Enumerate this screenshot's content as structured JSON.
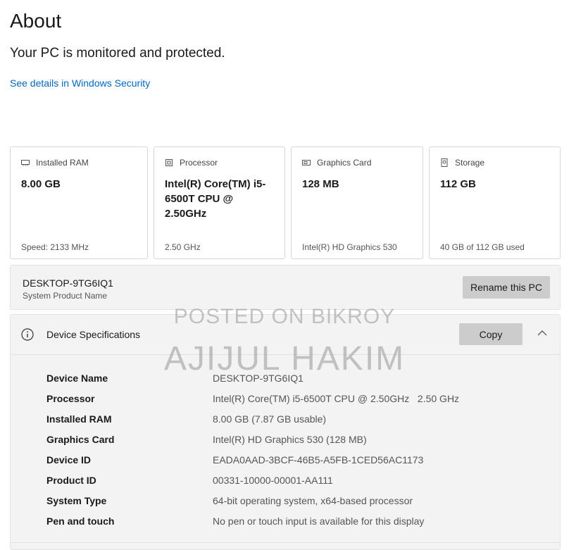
{
  "page": {
    "title": "About",
    "status": "Your PC is monitored and protected.",
    "security_link": "See details in Windows Security"
  },
  "cards": [
    {
      "icon": "memory-icon",
      "label": "Installed RAM",
      "value": "8.00 GB",
      "footer": "Speed: 2133 MHz"
    },
    {
      "icon": "processor-icon",
      "label": "Processor",
      "value": "Intel(R) Core(TM) i5-6500T CPU @ 2.50GHz",
      "footer": "2.50 GHz"
    },
    {
      "icon": "graphics-card-icon",
      "label": "Graphics Card",
      "value": "128 MB",
      "footer": "Intel(R) HD Graphics 530"
    },
    {
      "icon": "storage-icon",
      "label": "Storage",
      "value": "112 GB",
      "footer": "40 GB of 112 GB used"
    }
  ],
  "pc": {
    "name": "DESKTOP-9TG6IQ1",
    "subtitle": "System Product Name",
    "rename_label": "Rename this PC"
  },
  "specs": {
    "title": "Device Specifications",
    "copy_label": "Copy",
    "rows": [
      {
        "key": "Device Name",
        "value": "DESKTOP-9TG6IQ1"
      },
      {
        "key": "Processor",
        "value": "Intel(R) Core(TM) i5-6500T CPU @ 2.50GHz   2.50 GHz"
      },
      {
        "key": "Installed RAM",
        "value": "8.00 GB (7.87 GB usable)"
      },
      {
        "key": "Graphics Card",
        "value": "Intel(R) HD Graphics 530 (128 MB)"
      },
      {
        "key": "Device ID",
        "value": "EADA0AAD-3BCF-46B5-A5FB-1CED56AC1173"
      },
      {
        "key": "Product ID",
        "value": "00331-10000-00001-AA111"
      },
      {
        "key": "System Type",
        "value": "64-bit operating system, x64-based processor"
      },
      {
        "key": "Pen and touch",
        "value": "No pen or touch input is available for this display"
      }
    ]
  },
  "watermark": {
    "line1": "POSTED ON BIKROY",
    "line2": "AJIJUL HAKIM"
  },
  "colors": {
    "accent_link": "#0067c0",
    "button": "#cccccc",
    "panel": "#f3f3f3"
  }
}
